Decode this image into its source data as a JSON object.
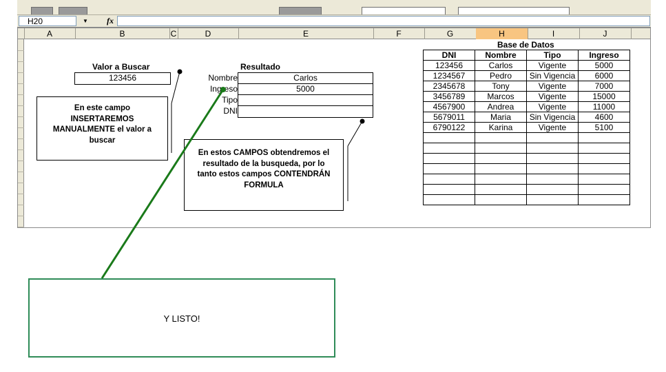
{
  "toolbar": {
    "visible": "cropped"
  },
  "formula_bar": {
    "name_box": "H20",
    "fx_symbol": "fx",
    "formula": ""
  },
  "columns": [
    {
      "letter": "A",
      "selected": false
    },
    {
      "letter": "B",
      "selected": false
    },
    {
      "letter": "C",
      "selected": false
    },
    {
      "letter": "D",
      "selected": false
    },
    {
      "letter": "E",
      "selected": false
    },
    {
      "letter": "F",
      "selected": false
    },
    {
      "letter": "G",
      "selected": false
    },
    {
      "letter": "H",
      "selected": true
    },
    {
      "letter": "I",
      "selected": false
    },
    {
      "letter": "J",
      "selected": false
    }
  ],
  "search": {
    "title": "Valor a Buscar",
    "value": "123456"
  },
  "result": {
    "title": "Resultado",
    "fields": [
      {
        "label": "Nombre",
        "value": "Carlos"
      },
      {
        "label": "Ingreso",
        "value": "5000"
      },
      {
        "label": "Tipo",
        "value": ""
      },
      {
        "label": "DNI",
        "value": ""
      }
    ]
  },
  "database": {
    "title": "Base de Datos",
    "headers": [
      "DNI",
      "Nombre",
      "Tipo",
      "Ingreso"
    ],
    "rows": [
      [
        "123456",
        "Carlos",
        "Vigente",
        "5000"
      ],
      [
        "1234567",
        "Pedro",
        "Sin Vigencia",
        "6000"
      ],
      [
        "2345678",
        "Tony",
        "Vigente",
        "7000"
      ],
      [
        "3456789",
        "Marcos",
        "Vigente",
        "15000"
      ],
      [
        "4567900",
        "Andrea",
        "Vigente",
        "11000"
      ],
      [
        "5679011",
        "Maria",
        "Sin Vigencia",
        "4600"
      ],
      [
        "6790122",
        "Karina",
        "Vigente",
        "5100"
      ],
      [
        "",
        "",
        "",
        ""
      ],
      [
        "",
        "",
        "",
        ""
      ],
      [
        "",
        "",
        "",
        ""
      ],
      [
        "",
        "",
        "",
        ""
      ],
      [
        "",
        "",
        "",
        ""
      ],
      [
        "",
        "",
        "",
        ""
      ],
      [
        "",
        "",
        "",
        ""
      ]
    ]
  },
  "notes": {
    "input_note": [
      "En este campo",
      "INSERTAREMOS",
      "MANUALMENTE el valor a",
      "buscar"
    ],
    "formula_note": [
      "En estos CAMPOS obtendremos el",
      "resultado de la busqueda, por lo",
      "tanto estos campos CONTENDRÁN",
      "FORMULA"
    ]
  },
  "callout": {
    "text": "Y LISTO!",
    "border_color": "#2e8b57",
    "line_color": "#1a7a1a"
  }
}
